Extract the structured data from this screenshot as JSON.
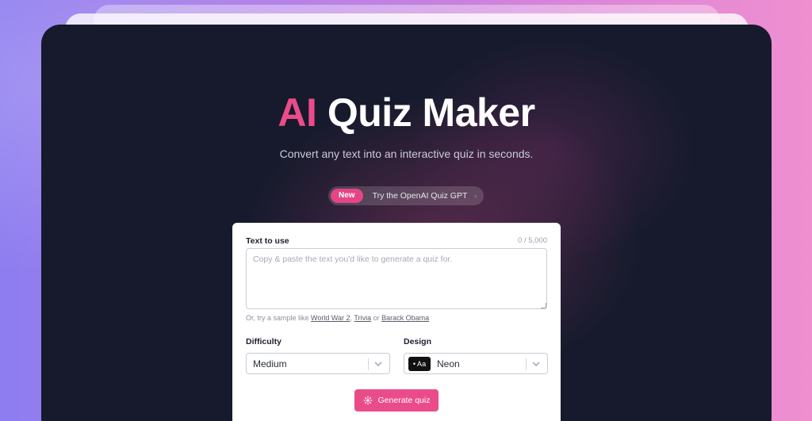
{
  "hero": {
    "title_accent": "AI",
    "title_rest": "Quiz Maker",
    "subtitle": "Convert any text into an interactive quiz in seconds."
  },
  "announcement": {
    "badge": "New",
    "text": "Try the OpenAI Quiz GPT",
    "chevron": "›"
  },
  "form": {
    "text_label": "Text to use",
    "counter": "0 / 5,000",
    "text_value": "",
    "text_placeholder": "Copy & paste the text you'd like to generate a quiz for.",
    "sample_prefix": "Or, try a sample like",
    "samples": [
      "World War 2",
      "Trivia",
      "Barack Obama"
    ],
    "sample_sep": ",",
    "sample_or": "or",
    "difficulty_label": "Difficulty",
    "difficulty_value": "Medium",
    "design_label": "Design",
    "design_thumb": "• Aa",
    "design_value": "Neon",
    "generate_label": "Generate quiz"
  },
  "colors": {
    "accent": "#ea4c89",
    "card_bg": "#161a2c"
  },
  "icons": {
    "chevron": "chevron-down-icon",
    "generate": "sparkle-icon"
  }
}
